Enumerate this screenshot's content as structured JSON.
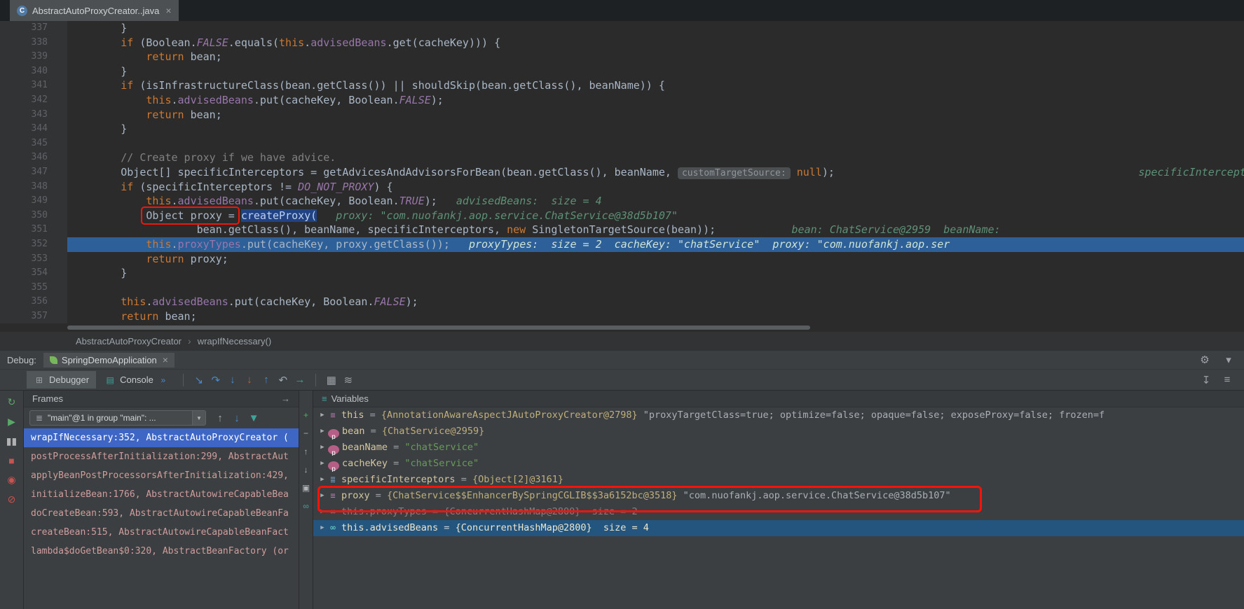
{
  "editor_tab": {
    "title": "AbstractAutoProxyCreator..java",
    "close_label": "×",
    "icon_letter": "C"
  },
  "breadcrumb": {
    "items": [
      "AbstractAutoProxyCreator",
      "wrapIfNecessary()"
    ],
    "separator": "›"
  },
  "code": {
    "lines": [
      {
        "num": "337",
        "tokens": [
          [
            "pl",
            "        }"
          ]
        ]
      },
      {
        "num": "338",
        "tokens": [
          [
            "pl",
            "        "
          ],
          [
            "kw",
            "if"
          ],
          [
            "pl",
            " (Boolean."
          ],
          [
            "cst",
            "FALSE"
          ],
          [
            "pl",
            ".equals("
          ],
          [
            "kw",
            "this"
          ],
          [
            "pl",
            "."
          ],
          [
            "fld",
            "advisedBeans"
          ],
          [
            "pl",
            ".get(cacheKey))) {"
          ]
        ]
      },
      {
        "num": "339",
        "tokens": [
          [
            "pl",
            "            "
          ],
          [
            "kw",
            "return"
          ],
          [
            "pl",
            " bean;"
          ]
        ]
      },
      {
        "num": "340",
        "tokens": [
          [
            "pl",
            "        }"
          ]
        ]
      },
      {
        "num": "341",
        "tokens": [
          [
            "pl",
            "        "
          ],
          [
            "kw",
            "if"
          ],
          [
            "pl",
            " (isInfrastructureClass(bean.getClass()) || shouldSkip(bean.getClass(), beanName)) {"
          ]
        ]
      },
      {
        "num": "342",
        "tokens": [
          [
            "pl",
            "            "
          ],
          [
            "kw",
            "this"
          ],
          [
            "pl",
            "."
          ],
          [
            "fld",
            "advisedBeans"
          ],
          [
            "pl",
            ".put(cacheKey, Boolean."
          ],
          [
            "cst",
            "FALSE"
          ],
          [
            "pl",
            ");"
          ]
        ]
      },
      {
        "num": "343",
        "tokens": [
          [
            "pl",
            "            "
          ],
          [
            "kw",
            "return"
          ],
          [
            "pl",
            " bean;"
          ]
        ]
      },
      {
        "num": "344",
        "tokens": [
          [
            "pl",
            "        }"
          ]
        ]
      },
      {
        "num": "345",
        "tokens": []
      },
      {
        "num": "346",
        "tokens": [
          [
            "pl",
            "        "
          ],
          [
            "cm",
            "// Create proxy if we have advice."
          ]
        ]
      },
      {
        "num": "347",
        "tokens": [
          [
            "pl",
            "        Object[] specificInterceptors = getAdvicesAndAdvisorsForBean(bean.getClass(), beanName, "
          ],
          [
            "chip",
            "customTargetSource:"
          ],
          [
            "pl",
            " "
          ],
          [
            "kw",
            "null"
          ],
          [
            "pl",
            ");"
          ],
          [
            "hint",
            "                                                specificInterceptors:"
          ]
        ]
      },
      {
        "num": "348",
        "tokens": [
          [
            "pl",
            "        "
          ],
          [
            "kw",
            "if"
          ],
          [
            "pl",
            " (specificInterceptors != "
          ],
          [
            "cst",
            "DO_NOT_PROXY"
          ],
          [
            "pl",
            ") {"
          ]
        ]
      },
      {
        "num": "349",
        "tokens": [
          [
            "pl",
            "            "
          ],
          [
            "kw",
            "this"
          ],
          [
            "pl",
            "."
          ],
          [
            "fld",
            "advisedBeans"
          ],
          [
            "pl",
            ".put(cacheKey, Boolean."
          ],
          [
            "cst",
            "TRUE"
          ],
          [
            "pl",
            ");"
          ],
          [
            "hint",
            "   advisedBeans:  size = 4"
          ]
        ]
      },
      {
        "num": "350",
        "tokens": [
          [
            "pl",
            "            "
          ],
          [
            "box",
            "Object proxy ="
          ],
          [
            "pl",
            " "
          ],
          [
            "sel",
            "createProxy("
          ],
          [
            "hint",
            "   proxy: \"com.nuofankj.aop.service.ChatService@38d5b107\""
          ]
        ]
      },
      {
        "num": "351",
        "tokens": [
          [
            "pl",
            "                    bean.getClass(), beanName, specificInterceptors, "
          ],
          [
            "kw",
            "new"
          ],
          [
            "pl",
            " SingletonTargetSource(bean));"
          ],
          [
            "hint",
            "            bean: ChatService@2959  beanName:"
          ]
        ]
      },
      {
        "num": "352",
        "exec": true,
        "tokens": [
          [
            "pl",
            "            "
          ],
          [
            "kw",
            "this"
          ],
          [
            "pl",
            "."
          ],
          [
            "fld",
            "proxyTypes"
          ],
          [
            "pl",
            ".put(cacheKey, proxy.getClass());"
          ],
          [
            "hintb",
            "   proxyTypes:  size = 2  cacheKey: \"chatService\"  proxy: \"com.nuofankj.aop.ser"
          ]
        ]
      },
      {
        "num": "353",
        "tokens": [
          [
            "pl",
            "            "
          ],
          [
            "kw",
            "return"
          ],
          [
            "pl",
            " proxy;"
          ]
        ]
      },
      {
        "num": "354",
        "tokens": [
          [
            "pl",
            "        }"
          ]
        ]
      },
      {
        "num": "355",
        "tokens": []
      },
      {
        "num": "356",
        "tokens": [
          [
            "pl",
            "        "
          ],
          [
            "kw",
            "this"
          ],
          [
            "pl",
            "."
          ],
          [
            "fld",
            "advisedBeans"
          ],
          [
            "pl",
            ".put(cacheKey, Boolean."
          ],
          [
            "cst",
            "FALSE"
          ],
          [
            "pl",
            ");"
          ]
        ]
      },
      {
        "num": "357",
        "tokens": [
          [
            "pl",
            "        "
          ],
          [
            "kw",
            "return"
          ],
          [
            "pl",
            " bean;"
          ]
        ]
      }
    ]
  },
  "debug": {
    "label": "Debug:",
    "session_tab": {
      "label": "SpringDemoApplication",
      "close_label": "×"
    },
    "header_icons": [
      {
        "name": "settings-gear-icon",
        "glyph": "⚙",
        "color": "#9da2a8"
      },
      {
        "name": "chevron-down-icon",
        "glyph": "▾",
        "color": "#9da2a8"
      }
    ],
    "toolbar": {
      "tabs": [
        {
          "label": "Debugger",
          "icon_glyph": "⊞",
          "selected": true
        },
        {
          "label": "Console",
          "icon_glyph": "▤",
          "selected": false
        }
      ],
      "console_extra_glyph": "»",
      "step_icons": [
        {
          "name": "show-execution-point-icon",
          "glyph": "↘",
          "color": "#4a88c7"
        },
        {
          "name": "step-over-icon",
          "glyph": "↷",
          "color": "#4a88c7"
        },
        {
          "name": "step-into-icon",
          "glyph": "↓",
          "color": "#4a88c7"
        },
        {
          "name": "force-step-into-icon",
          "glyph": "↓",
          "color": "#c75450"
        },
        {
          "name": "step-out-icon",
          "glyph": "↑",
          "color": "#4a88c7"
        },
        {
          "name": "drop-frame-icon",
          "glyph": "↶",
          "color": "#9aa7b0"
        },
        {
          "name": "run-to-cursor-icon",
          "glyph": "→",
          "color": "#3fa39a"
        }
      ],
      "aux_icons": [
        {
          "name": "restore-layout-icon",
          "glyph": "▦",
          "color": "#9aa0a5"
        },
        {
          "name": "threads-view-icon",
          "glyph": "≋",
          "color": "#9aa0a5"
        }
      ],
      "right_icons": [
        {
          "name": "scroll-down-icon",
          "glyph": "↧",
          "color": "#9aa0a5"
        },
        {
          "name": "settings-menu-icon",
          "glyph": "≡",
          "color": "#9aa0a5"
        }
      ]
    },
    "left_strip": [
      {
        "name": "rerun-debug-icon",
        "glyph": "↻",
        "color": "#59a869"
      },
      {
        "name": "resume-icon",
        "glyph": "▶",
        "color": "#59a869"
      },
      {
        "name": "pause-icon",
        "glyph": "▮▮",
        "color": "#afb1b3"
      },
      {
        "name": "stop-icon",
        "glyph": "■",
        "color": "#c75450"
      },
      {
        "name": "view-breakpoints-icon",
        "glyph": "◉",
        "color": "#c75450"
      },
      {
        "name": "mute-breakpoints-icon",
        "glyph": "⊘",
        "color": "#c75450"
      }
    ],
    "frames": {
      "header": "Frames",
      "header_icon_glyph": "→",
      "thread": {
        "icon_glyph": "≣",
        "label": "\"main\"@1 in group \"main\": ...",
        "arrow_glyph": "▼"
      },
      "nav_icons": [
        {
          "name": "previous-frame-icon",
          "glyph": "↑",
          "color": "#a9adb0"
        },
        {
          "name": "next-frame-icon",
          "glyph": "↓",
          "color": "#4a88c7"
        },
        {
          "name": "filter-frames-icon",
          "glyph": "▼",
          "color": "#3fa39a"
        }
      ],
      "items": [
        {
          "text": "wrapIfNecessary:352, AbstractAutoProxyCreator (",
          "selected": true
        },
        {
          "text": "postProcessAfterInitialization:299, AbstractAut"
        },
        {
          "text": "applyBeanPostProcessorsAfterInitialization:429,"
        },
        {
          "text": "initializeBean:1766, AbstractAutowireCapableBea"
        },
        {
          "text": "doCreateBean:593, AbstractAutowireCapableBeanFa"
        },
        {
          "text": "createBean:515, AbstractAutowireCapableBeanFact"
        },
        {
          "text": "lambda$doGetBean$0:320, AbstractBeanFactory (or"
        }
      ]
    },
    "watch_strip": [
      {
        "name": "add-watch-icon",
        "glyph": "+",
        "color": "#59a869"
      },
      {
        "name": "remove-watch-icon",
        "glyph": "−",
        "color": "#afb3b6"
      },
      {
        "name": "move-watch-up-icon",
        "glyph": "↑",
        "color": "#afb3b6"
      },
      {
        "name": "move-watch-down-icon",
        "glyph": "↓",
        "color": "#afb3b6"
      },
      {
        "name": "duplicate-watch-icon",
        "glyph": "▣",
        "color": "#afb3b6"
      },
      {
        "name": "show-watches-icon",
        "glyph": "∞",
        "color": "#3fa39a"
      }
    ],
    "variables": {
      "header": "Variables",
      "header_icon_glyph": "≡",
      "expand_glyph": "▶",
      "icon_glyphs": {
        "object": "≡",
        "param": "p",
        "array": "≣",
        "watch": "∞"
      },
      "items": [
        {
          "icon": "object",
          "parts": [
            [
              "name",
              "this"
            ],
            [
              "eq",
              " = "
            ],
            [
              "ref",
              "{AnnotationAwareAspectJAutoProxyCreator@2798}"
            ],
            [
              "strg",
              " \"proxyTargetClass=true; optimize=false; opaque=false; exposeProxy=false; frozen=f"
            ]
          ]
        },
        {
          "icon": "param",
          "parts": [
            [
              "name",
              "bean"
            ],
            [
              "eq",
              " = "
            ],
            [
              "ref",
              "{ChatService@2959}"
            ]
          ]
        },
        {
          "icon": "param",
          "parts": [
            [
              "name",
              "beanName"
            ],
            [
              "eq",
              " = "
            ],
            [
              "str",
              "\"chatService\""
            ]
          ]
        },
        {
          "icon": "param",
          "parts": [
            [
              "name",
              "cacheKey"
            ],
            [
              "eq",
              " = "
            ],
            [
              "str",
              "\"chatService\""
            ]
          ]
        },
        {
          "icon": "array",
          "parts": [
            [
              "name",
              "specificInterceptors"
            ],
            [
              "eq",
              " = "
            ],
            [
              "ref",
              "{Object[2]@3161}"
            ]
          ]
        },
        {
          "icon": "object",
          "parts": [
            [
              "name",
              "proxy"
            ],
            [
              "eq",
              " = "
            ],
            [
              "ref",
              "{ChatService$$EnhancerBySpringCGLIB$$3a6152bc@3518}"
            ],
            [
              "strg",
              " \"com.nuofankj.aop.service.ChatService@38d5b107\""
            ]
          ]
        },
        {
          "icon": "watch",
          "dim": true,
          "parts": [
            [
              "name",
              "this.proxyTypes"
            ],
            [
              "eq",
              " = "
            ],
            [
              "ref",
              "{ConcurrentHashMap@2800}"
            ],
            [
              "size",
              "  size = 2"
            ]
          ]
        },
        {
          "icon": "watch",
          "selected": true,
          "parts": [
            [
              "name",
              "this.advisedBeans"
            ],
            [
              "eq",
              " = "
            ],
            [
              "ref",
              "{ConcurrentHashMap@2800}"
            ],
            [
              "size",
              "  size = 4"
            ]
          ]
        }
      ]
    }
  }
}
